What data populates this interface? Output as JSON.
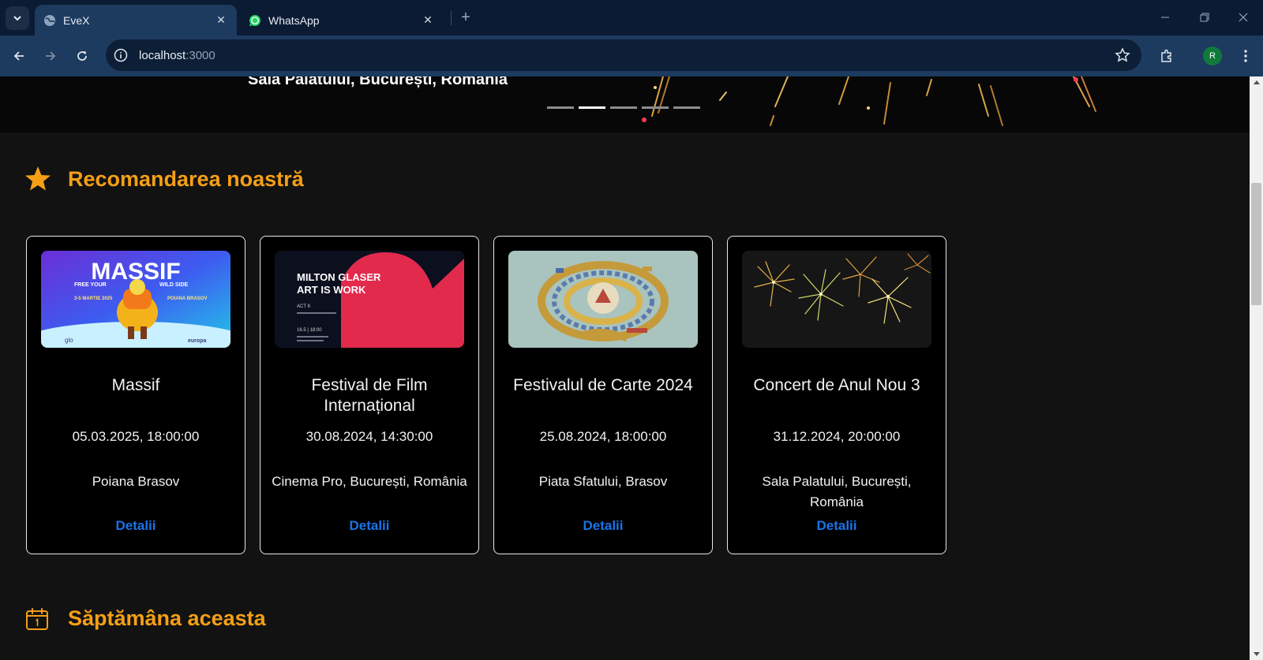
{
  "browser": {
    "tabs": [
      {
        "title": "EveX",
        "icon": "globe-icon",
        "active": true
      },
      {
        "title": "WhatsApp",
        "icon": "whatsapp-icon",
        "active": false
      }
    ],
    "url": {
      "host": "localhost",
      "port": ":3000"
    },
    "profile_initial": "R",
    "colors": {
      "frame": "#0b1b33",
      "toolbar": "#1d3a5f",
      "omnibox": "#0d1f36"
    }
  },
  "hero": {
    "location": "Sala Palatului, București, România",
    "carousel": {
      "slides": 5,
      "active_index": 1
    }
  },
  "sections": {
    "recommended": {
      "title": "Recomandarea noastră",
      "icon": "star-icon"
    },
    "this_week": {
      "title": "Săptămâna aceasta",
      "icon": "calendar-icon"
    }
  },
  "events": [
    {
      "title": "Massif",
      "date": "05.03.2025, 18:00:00",
      "location": "Poiana Brasov",
      "link": "Detalii",
      "poster": {
        "headline": "MASSIF",
        "tagline_left": "FREE YOUR",
        "tagline_right": "WILD SIDE",
        "dates": "3-5 MARTIE 2025",
        "place": "POIANA BRASOV",
        "sponsor_left": "glo",
        "sponsor_right": "europa"
      }
    },
    {
      "title": "Festival de Film Internațional",
      "date": "30.08.2024, 14:30:00",
      "location": "Cinema Pro, București, România",
      "link": "Detalii",
      "poster": {
        "line1": "MILTON GLASER",
        "line2": "ART IS WORK",
        "act": "ACT II",
        "time": "16.5 | 18:00"
      }
    },
    {
      "title": "Festivalul de Carte 2024",
      "date": "25.08.2024, 18:00:00",
      "location": "Piata Sfatului, Brasov",
      "link": "Detalii"
    },
    {
      "title": "Concert de Anul Nou 3",
      "date": "31.12.2024, 20:00:00",
      "location": "Sala Palatului, București, România",
      "link": "Detalii"
    }
  ],
  "theme": {
    "accent": "#f59f16",
    "link": "#1a73e8",
    "card_border": "#e8e8e8"
  }
}
